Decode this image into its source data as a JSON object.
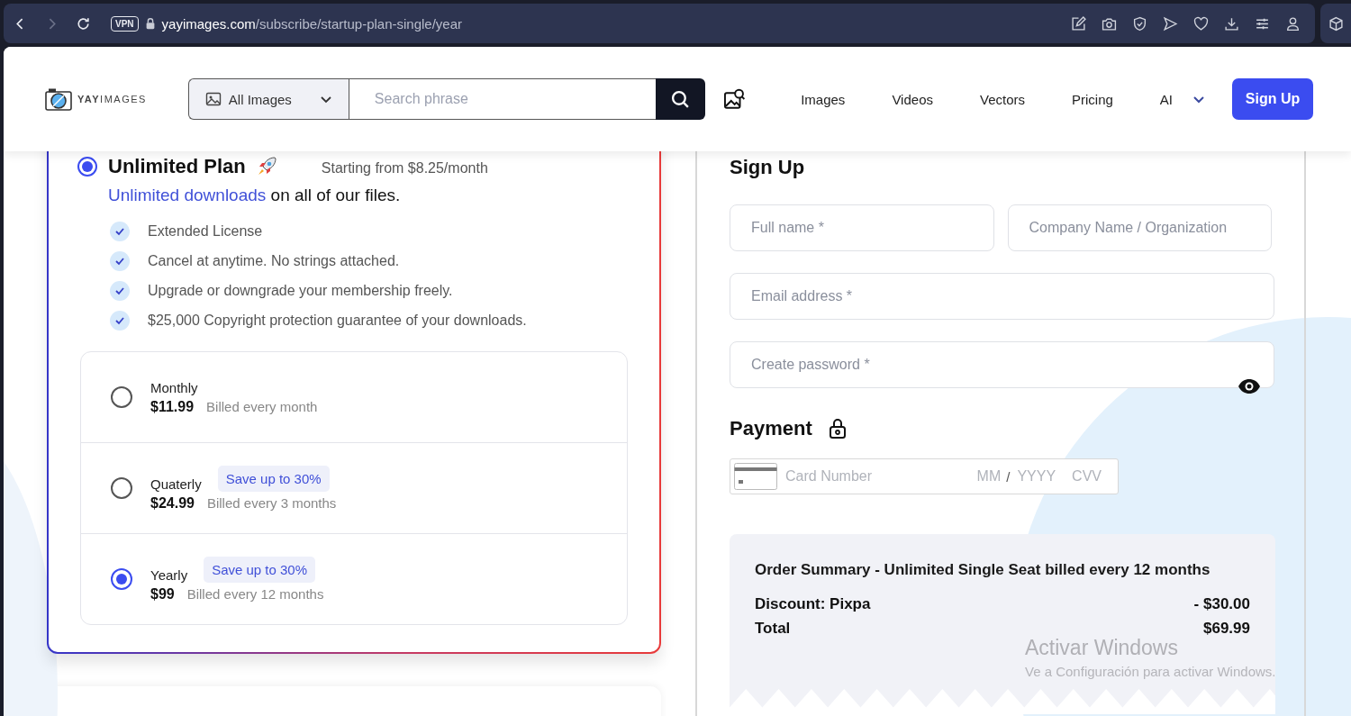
{
  "browser": {
    "vpn": "VPN",
    "url_host": "yayimages.com",
    "url_path": "/subscribe/startup-plan-single/year"
  },
  "header": {
    "logo": "**YAY**IMAGES",
    "category": "All Images",
    "search_placeholder": "Search phrase",
    "nav": [
      "Images",
      "Videos",
      "Vectors",
      "Pricing",
      "AI"
    ],
    "signup": "Sign Up"
  },
  "plan": {
    "selected": true,
    "title": "Unlimited Plan",
    "starting": "Starting from $8.25/month",
    "link": "Unlimited downloads",
    "rest": "on all of our files.",
    "features": [
      "Extended License",
      "Cancel at anytime. No strings attached.",
      "Upgrade or downgrade your membership freely.",
      "$25,000 Copyright protection guarantee of your downloads."
    ],
    "options": [
      {
        "name": "Monthly",
        "price": "$11.99",
        "billing": "Billed every month",
        "selected": false
      },
      {
        "name": "Quaterly",
        "badge": "Save up to 30%",
        "price": "$24.99",
        "billing": "Billed every 3 months",
        "selected": false
      },
      {
        "name": "Yearly",
        "badge": "Save up to 30%",
        "price": "$99",
        "billing": "Billed every 12 months",
        "selected": true
      }
    ]
  },
  "signup": {
    "title": "Sign Up",
    "full_name": {
      "placeholder": "Full name *"
    },
    "company": {
      "placeholder": "Company Name / Organization"
    },
    "email": {
      "placeholder": "Email address *"
    },
    "password": {
      "placeholder": "Create password *"
    },
    "payment": "Payment",
    "card": {
      "number": "Card Number",
      "month": "MM",
      "separator": "/",
      "year": "YYYY",
      "cvv": "CVV"
    }
  },
  "summary": {
    "title": "Order Summary - Unlimited Single Seat billed every 12 months",
    "rows": [
      {
        "label": "Discount: Pixpa",
        "value": "- $30.00"
      },
      {
        "label": "Total",
        "value": "$69.99"
      }
    ]
  },
  "os_notice": {
    "title": "Activar Windows",
    "text": "Ve a Configuración para activar Windows."
  }
}
